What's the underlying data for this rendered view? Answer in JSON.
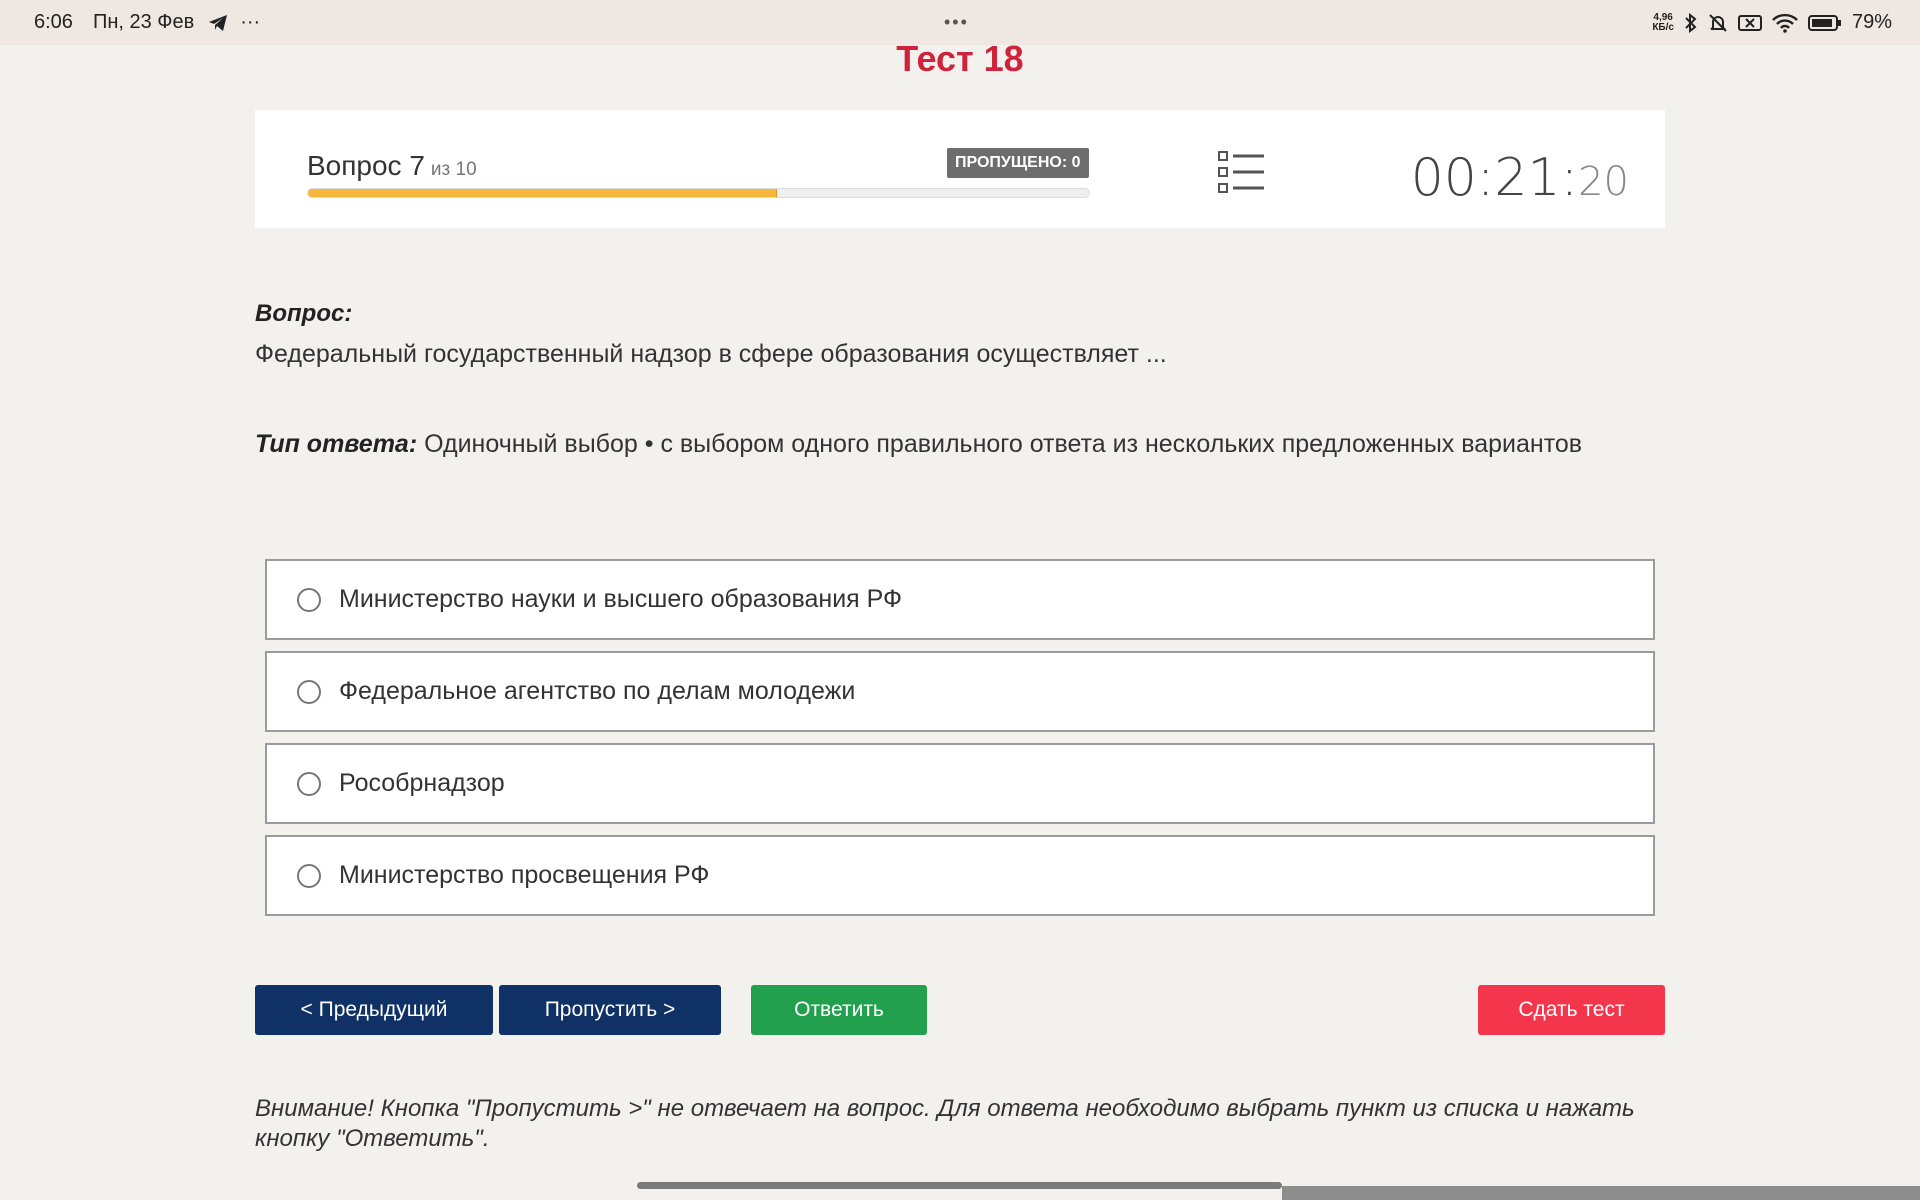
{
  "statusbar": {
    "time": "6:06",
    "date": "Пн, 23 Фев",
    "more": "···",
    "center_dots": "•••",
    "speed_value": "4,96",
    "speed_unit": "КБ/с",
    "battery": "79%"
  },
  "test": {
    "title": "Тест 18"
  },
  "header": {
    "question_prefix": "Вопрос 7",
    "question_of": "из 10",
    "skipped": "ПРОПУЩЕНО: 0",
    "progress": 0.6,
    "timer_main": "00:21:",
    "timer_sec": "20"
  },
  "question": {
    "label": "Вопрос:",
    "text": "Федеральный государственный надзор в сфере образования осуществляет ...",
    "type_label": "Тип ответа:",
    "type_value": " Одиночный выбор • с выбором одного правильного ответа из нескольких предложенных вариантов"
  },
  "options": [
    {
      "label": "Министерство науки и высшего образования РФ"
    },
    {
      "label": "Федеральное агентство по делам молодежи"
    },
    {
      "label": "Рособрнадзор"
    },
    {
      "label": "Министерство просвещения РФ"
    }
  ],
  "buttons": {
    "prev": "< Предыдущий",
    "skip": "Пропустить >",
    "answer": "Ответить",
    "finish": "Сдать тест"
  },
  "notice": "Внимание! Кнопка \"Пропустить >\" не отвечает на вопрос. Для ответа необходимо выбрать пункт из списка и нажать кнопку \"Ответить\".",
  "colors": {
    "title": "#d0223b",
    "progress": "#f6b73c",
    "nav_button": "#0f3166",
    "answer_button": "#23a04e",
    "finish_button": "#f4364c"
  }
}
